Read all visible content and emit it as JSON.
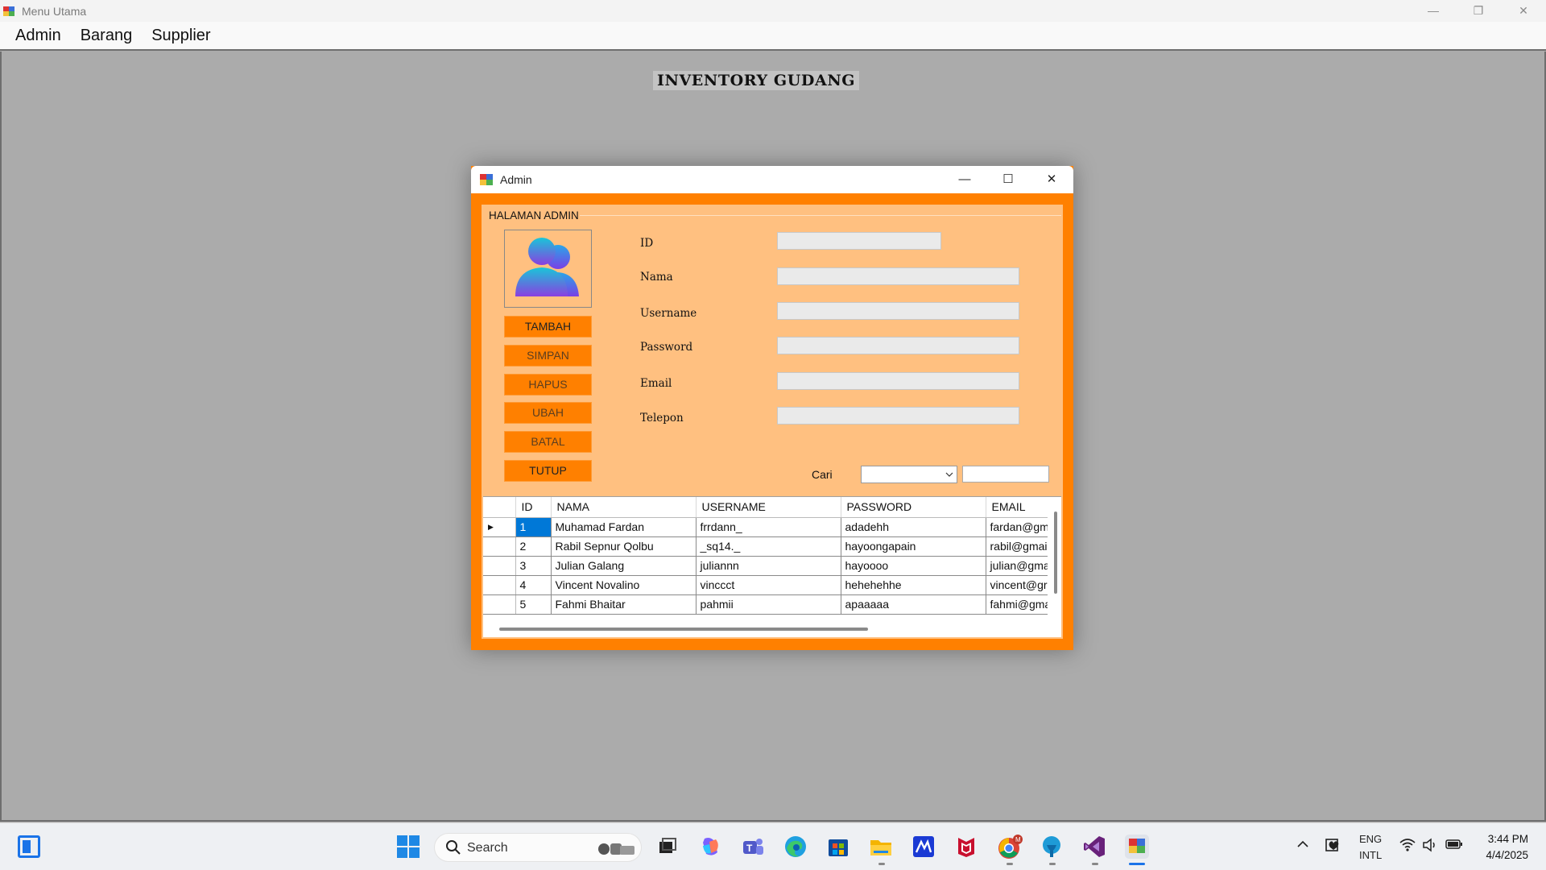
{
  "main_window": {
    "title": "Menu Utama",
    "controls": {
      "minimize": "—",
      "restore": "❐",
      "close": "✕"
    }
  },
  "menu": [
    "Admin",
    "Barang",
    "Supplier"
  ],
  "heading": "INVENTORY GUDANG",
  "dialog": {
    "title": "Admin",
    "controls": {
      "minimize": "—",
      "maximize": "☐",
      "close": "✕"
    },
    "group_label": "HALAMAN ADMIN",
    "buttons": [
      "TAMBAH",
      "SIMPAN",
      "HAPUS",
      "UBAH",
      "BATAL",
      "TUTUP"
    ],
    "fields": {
      "id": {
        "label": "ID",
        "value": ""
      },
      "nama": {
        "label": "Nama",
        "value": ""
      },
      "username": {
        "label": "Username",
        "value": ""
      },
      "password": {
        "label": "Password",
        "value": ""
      },
      "email": {
        "label": "Email",
        "value": ""
      },
      "telepon": {
        "label": "Telepon",
        "value": ""
      }
    },
    "search": {
      "label": "Cari",
      "select_value": "",
      "input_value": ""
    },
    "grid": {
      "columns": [
        "ID",
        "NAMA",
        "USERNAME",
        "PASSWORD",
        "EMAIL"
      ],
      "rows": [
        [
          "1",
          "Muhamad Fardan",
          "frrdann_",
          "adadehh",
          "fardan@gm"
        ],
        [
          "2",
          "Rabil Sepnur Qolbu",
          "_sq14._",
          "hayoongapain",
          "rabil@gmai"
        ],
        [
          "3",
          "Julian Galang",
          "juliannn",
          "hayoooo",
          "julian@gma"
        ],
        [
          "4",
          "Vincent Novalino",
          "vinccct",
          "hehehehhe",
          "vincent@gr"
        ],
        [
          "5",
          "Fahmi Bhaitar",
          "pahmii",
          "apaaaaa",
          "fahmi@gma"
        ]
      ],
      "selected_row": 0
    }
  },
  "taskbar": {
    "search_placeholder": "Search",
    "lang_primary": "ENG",
    "lang_secondary": "INTL",
    "time": "3:44 PM",
    "date": "4/4/2025"
  },
  "colors": {
    "accent_orange": "#ff8000",
    "panel_peach": "#ffc080",
    "selection_blue": "#0078d7"
  }
}
